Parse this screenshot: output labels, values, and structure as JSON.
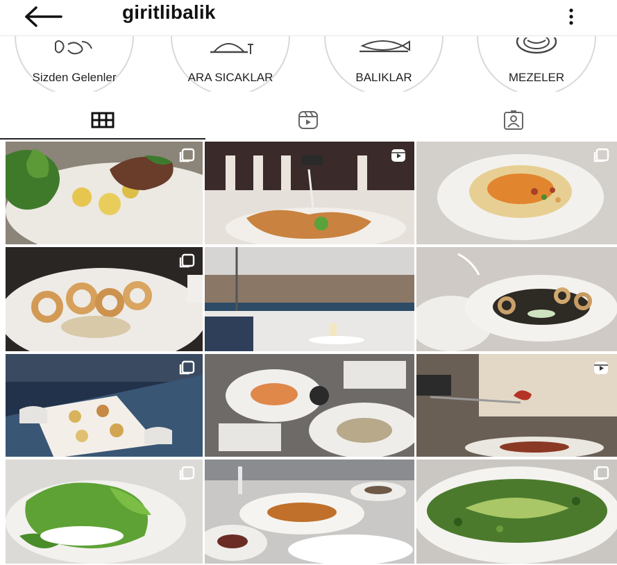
{
  "header": {
    "username": "giritlibalik",
    "back_icon": "arrow-left-icon",
    "more_icon": "vertical-dots-icon"
  },
  "highlights": [
    {
      "label": "Sizden Gelenler",
      "icon": "hands-icon"
    },
    {
      "label": "ARA SICAKLAR",
      "icon": "serving-dish-icon"
    },
    {
      "label": "BALIKLAR",
      "icon": "fish-icon"
    },
    {
      "label": "MEZELER",
      "icon": "plate-icon"
    }
  ],
  "tabs": [
    {
      "name": "posts",
      "icon": "grid-icon",
      "active": true
    },
    {
      "name": "reels",
      "icon": "reels-icon",
      "active": false
    },
    {
      "name": "tagged",
      "icon": "tagged-person-icon",
      "active": false
    }
  ],
  "posts": [
    {
      "type": "carousel",
      "subject": "greens, potatoes and octopus"
    },
    {
      "type": "reel",
      "subject": "pasta with grated cheese"
    },
    {
      "type": "carousel",
      "subject": "hummus on white plate"
    },
    {
      "type": "carousel",
      "subject": "fried calamari rings"
    },
    {
      "type": "photo",
      "subject": "restaurant window view"
    },
    {
      "type": "photo",
      "subject": "squid ink pasta with mussels"
    },
    {
      "type": "carousel",
      "subject": "terrace table by the sea"
    },
    {
      "type": "photo",
      "subject": "set table with meze plates"
    },
    {
      "type": "reel",
      "subject": "fork with cured meat"
    },
    {
      "type": "carousel",
      "subject": "green vegetables with yogurt"
    },
    {
      "type": "photo",
      "subject": "dinner table with fish plates"
    },
    {
      "type": "carousel",
      "subject": "avocado salad"
    }
  ],
  "colors": {
    "text": "#111111",
    "divider": "#e6e6e6",
    "ring": "#d9d9d9",
    "icon": "#222222"
  }
}
